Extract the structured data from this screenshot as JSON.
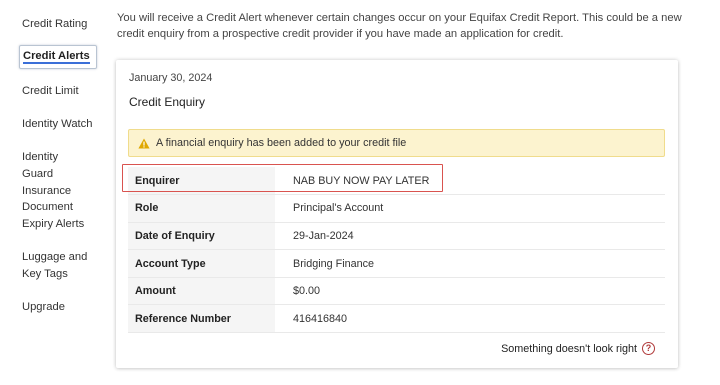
{
  "sidebar": {
    "items": [
      {
        "label": "Credit Rating"
      },
      {
        "label": "Credit Alerts",
        "active": true
      },
      {
        "label": "Credit Limit"
      },
      {
        "label": "Identity Watch"
      },
      {
        "label": "Identity Guard Insurance"
      },
      {
        "label": "Document Expiry Alerts"
      },
      {
        "label": "Luggage and Key Tags"
      },
      {
        "label": "Upgrade"
      }
    ]
  },
  "intro_text": "You will receive a Credit Alert whenever certain changes occur on your Equifax Credit Report. This could be a new credit enquiry from a prospective credit provider if you have made an application for credit.",
  "alert_card": {
    "date": "January 30, 2024",
    "title": "Credit Enquiry",
    "notice": "A financial enquiry has been added to your credit file",
    "rows": [
      {
        "label": "Enquirer",
        "value": "NAB BUY NOW PAY LATER"
      },
      {
        "label": "Role",
        "value": "Principal's Account"
      },
      {
        "label": "Date of Enquiry",
        "value": "29-Jan-2024"
      },
      {
        "label": "Account Type",
        "value": "Bridging Finance"
      },
      {
        "label": "Amount",
        "value": "$0.00"
      },
      {
        "label": "Reference Number",
        "value": "416416840"
      }
    ],
    "help_link": "Something doesn't look right",
    "help_icon": "?"
  },
  "colors": {
    "alert_background": "#fcf3cf",
    "warning_icon": "#e0a800",
    "highlight_border": "#d9534f",
    "help_icon": "#b03a3a",
    "active_underline": "#3b6fd8"
  },
  "icons": {
    "notice": "warning-triangle-icon",
    "help": "question-circle-icon"
  }
}
